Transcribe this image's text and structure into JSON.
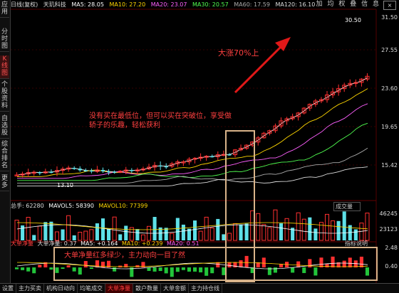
{
  "sidebar": {
    "items": [
      {
        "label": "应用",
        "active": false
      },
      {
        "label": "分时图",
        "active": false
      },
      {
        "label": "K线图",
        "active": true
      },
      {
        "label": "个股资料",
        "active": false
      },
      {
        "label": "自选股",
        "active": false
      },
      {
        "label": "综合排名",
        "active": false
      },
      {
        "label": "更多",
        "active": false
      }
    ]
  },
  "header": {
    "period": "日线(复权)",
    "stock": "天玑科技",
    "ma5": "MA5: 28.05",
    "ma10": "MA10: 27.20",
    "ma20": "MA20: 23.07",
    "ma30": "MA30: 20.57",
    "ma60": "MA60: 17.59",
    "ma120": "MA120: 16.10"
  },
  "toolbar": {
    "items": [
      "加",
      "均",
      "权",
      "叠",
      "信",
      "息"
    ],
    "close": "×"
  },
  "price_axis": [
    "31.50",
    "27.55",
    "23.60",
    "19.65",
    "15.42"
  ],
  "volume_axis": [
    "46245",
    "23123"
  ],
  "flow_axis": [
    "2.48",
    "0.40"
  ],
  "price_labels": {
    "high": "30.50",
    "low": "13.10"
  },
  "annotations": {
    "rise": "大涨70%上",
    "breakout": "没有买在最低位，但可以买在突破位，享受做轿子的乐趣，轻松获利",
    "flow": "大单净量红多绿少，主力动向一目了然"
  },
  "volume_header": {
    "name": "总手: 62280",
    "mavol5": "MAVOL5: 58390",
    "mavol10": "MAVOL10: 77399",
    "selector": "成交量"
  },
  "flow_header": {
    "name": "大单净量",
    "net": "大单净量: 0.37",
    "ma5": "MA5: +0.164",
    "ma10": "MA10: +0.239",
    "ma20": "MA20: 0.51",
    "help": "指标说明"
  },
  "tabs": [
    {
      "label": "设置",
      "active": false
    },
    {
      "label": "主力买卖",
      "active": false
    },
    {
      "label": "机构日动向",
      "active": false
    },
    {
      "label": "均笔成交",
      "active": false
    },
    {
      "label": "大单净量",
      "active": true
    },
    {
      "label": "散户数量",
      "active": false
    },
    {
      "label": "大单金额",
      "active": false
    },
    {
      "label": "主力持仓线",
      "active": false
    }
  ],
  "colors": {
    "up": "#ff3030",
    "down": "#5ee0e8",
    "flow_down": "#22c43a",
    "annot": "#ff4040",
    "box": "#d9b48a"
  }
}
